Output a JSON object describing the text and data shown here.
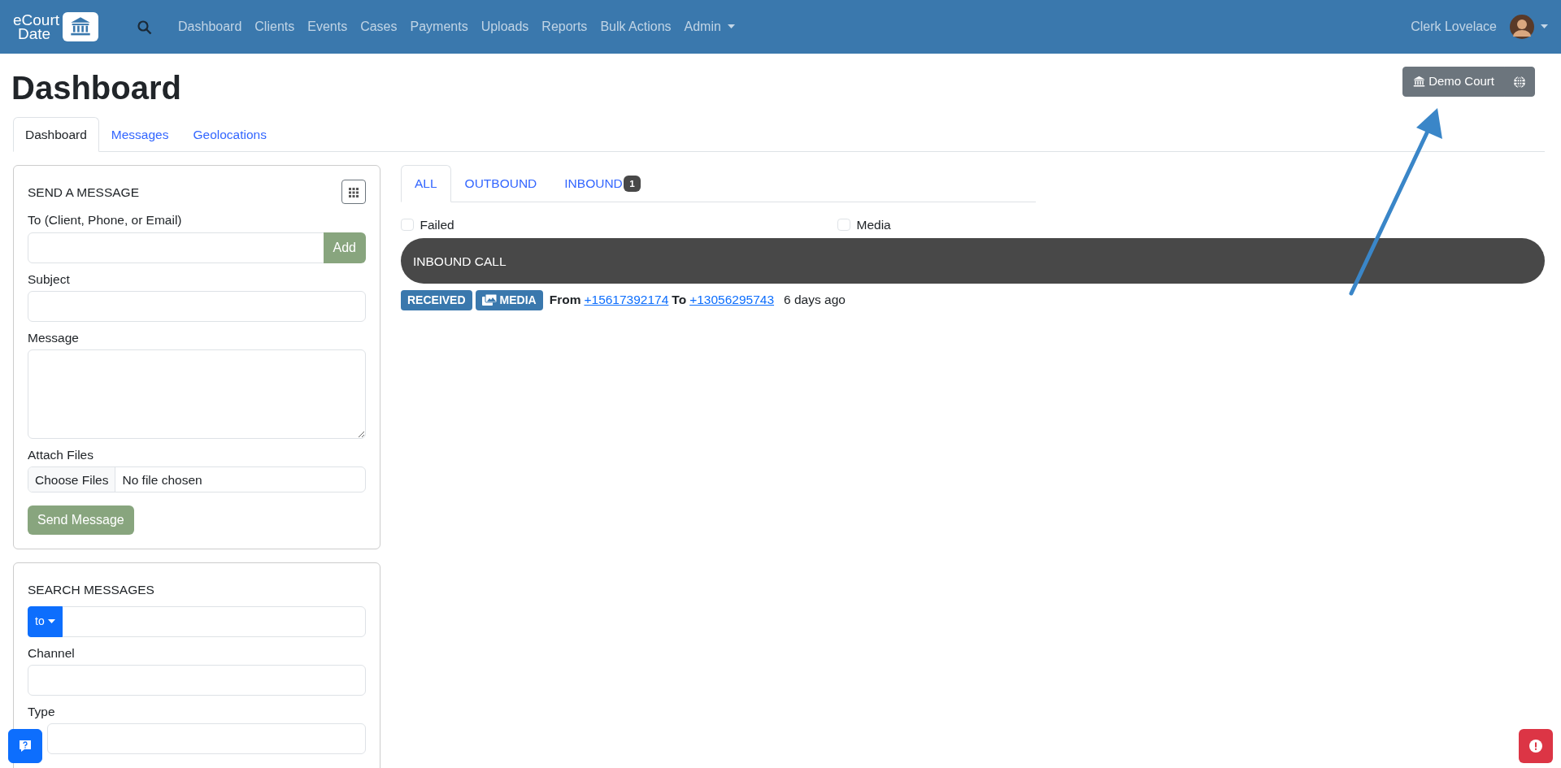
{
  "navbar": {
    "brand": [
      "eCourt",
      "Date"
    ],
    "links": [
      {
        "label": "Dashboard",
        "dropdown": false
      },
      {
        "label": "Clients",
        "dropdown": false
      },
      {
        "label": "Events",
        "dropdown": false
      },
      {
        "label": "Cases",
        "dropdown": false
      },
      {
        "label": "Payments",
        "dropdown": false
      },
      {
        "label": "Uploads",
        "dropdown": false
      },
      {
        "label": "Reports",
        "dropdown": false
      },
      {
        "label": "Bulk Actions",
        "dropdown": false
      },
      {
        "label": "Admin",
        "dropdown": true
      }
    ],
    "user": {
      "name": "Clerk Lovelace"
    }
  },
  "page": {
    "title": "Dashboard",
    "court_button": "Demo Court"
  },
  "tabs": [
    {
      "label": "Dashboard",
      "selected": true
    },
    {
      "label": "Messages",
      "selected": false
    },
    {
      "label": "Geolocations",
      "selected": false
    }
  ],
  "send_message": {
    "title": "SEND A MESSAGE",
    "fields": [
      {
        "kind": "input-add",
        "label": "To (Client, Phone, or Email)",
        "button": "Add"
      },
      {
        "kind": "input",
        "label": "Subject"
      },
      {
        "kind": "textarea",
        "label": "Message"
      },
      {
        "kind": "file",
        "label": "Attach Files",
        "button": "Choose Files",
        "value": "No file chosen"
      }
    ],
    "submit": "Send Message"
  },
  "search_messages": {
    "title": "SEARCH MESSAGES",
    "dropdown": "to",
    "fields": [
      {
        "label": "Channel"
      },
      {
        "label": "Type"
      }
    ]
  },
  "message_tabs": [
    {
      "label": "ALL",
      "selected": true
    },
    {
      "label": "OUTBOUND",
      "selected": false
    },
    {
      "label": "INBOUND",
      "selected": false,
      "count": "1"
    }
  ],
  "filters": [
    {
      "label": "Failed",
      "checked": false
    },
    {
      "label": "Media",
      "checked": false
    }
  ],
  "messages": [
    {
      "title": "INBOUND CALL",
      "status": "RECEIVED",
      "media": "MEDIA",
      "from_label": "From",
      "from": "+15617392174",
      "to_label": "To",
      "to": "+13056295743",
      "time": "6 days ago"
    }
  ]
}
